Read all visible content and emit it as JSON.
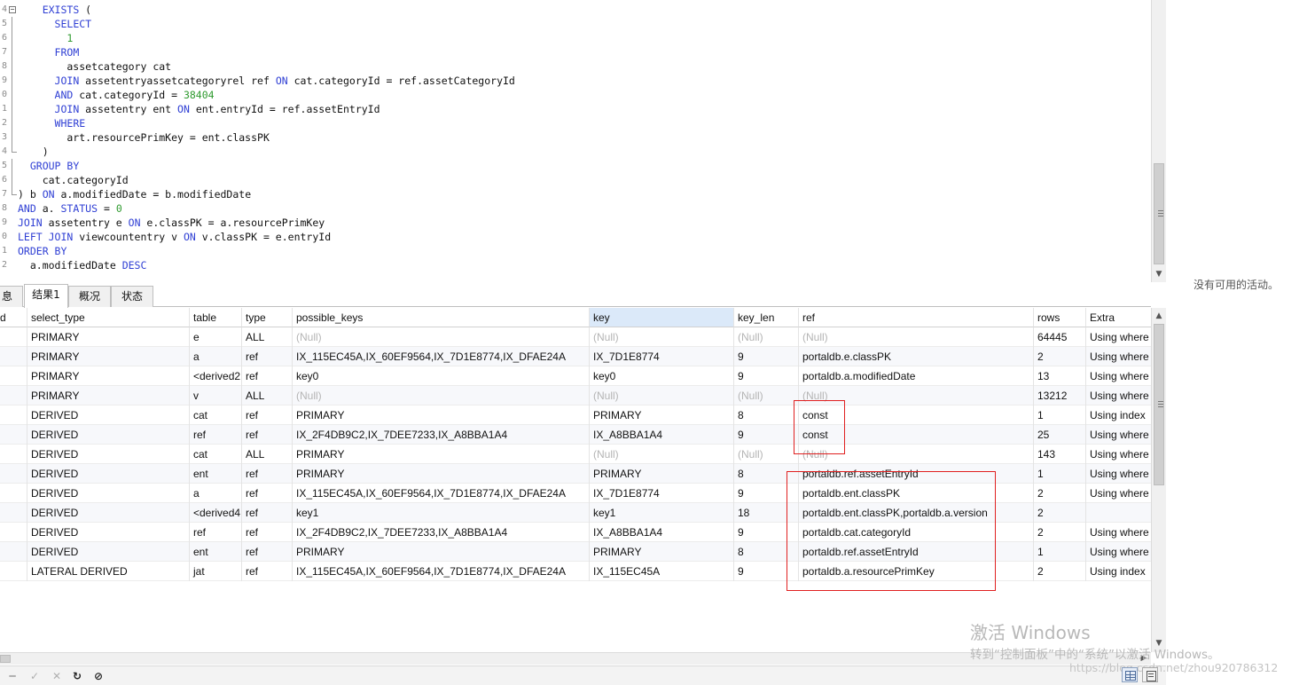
{
  "editor": {
    "lines": [
      {
        "num": "4",
        "fold": "box",
        "tokens": [
          [
            "tx",
            "    "
          ],
          [
            "kw",
            "EXISTS"
          ],
          [
            "tx",
            " ("
          ]
        ]
      },
      {
        "num": "5",
        "fold": "line",
        "tokens": [
          [
            "tx",
            "      "
          ],
          [
            "kw",
            "SELECT"
          ]
        ]
      },
      {
        "num": "6",
        "fold": "line",
        "tokens": [
          [
            "tx",
            "        "
          ],
          [
            "num",
            "1"
          ]
        ]
      },
      {
        "num": "7",
        "fold": "line",
        "tokens": [
          [
            "tx",
            "      "
          ],
          [
            "kw",
            "FROM"
          ]
        ]
      },
      {
        "num": "8",
        "fold": "line",
        "tokens": [
          [
            "tx",
            "        assetcategory cat"
          ]
        ]
      },
      {
        "num": "9",
        "fold": "line",
        "tokens": [
          [
            "tx",
            "      "
          ],
          [
            "kw",
            "JOIN"
          ],
          [
            "tx",
            " assetentryassetcategoryrel ref "
          ],
          [
            "kw",
            "ON"
          ],
          [
            "tx",
            " cat.categoryId = ref.assetCategoryId"
          ]
        ]
      },
      {
        "num": "0",
        "fold": "line",
        "tokens": [
          [
            "tx",
            "      "
          ],
          [
            "kw",
            "AND"
          ],
          [
            "tx",
            " cat.categoryId = "
          ],
          [
            "num",
            "38404"
          ]
        ]
      },
      {
        "num": "1",
        "fold": "line",
        "tokens": [
          [
            "tx",
            "      "
          ],
          [
            "kw",
            "JOIN"
          ],
          [
            "tx",
            " assetentry ent "
          ],
          [
            "kw",
            "ON"
          ],
          [
            "tx",
            " ent.entryId = ref.assetEntryId"
          ]
        ]
      },
      {
        "num": "2",
        "fold": "line",
        "tokens": [
          [
            "tx",
            "      "
          ],
          [
            "kw",
            "WHERE"
          ]
        ]
      },
      {
        "num": "3",
        "fold": "line",
        "tokens": [
          [
            "tx",
            "        art.resourcePrimKey = ent.classPK"
          ]
        ]
      },
      {
        "num": "4",
        "fold": "end",
        "tokens": [
          [
            "tx",
            "    )"
          ]
        ]
      },
      {
        "num": "5",
        "fold": "line",
        "tokens": [
          [
            "tx",
            "  "
          ],
          [
            "kw",
            "GROUP BY"
          ]
        ]
      },
      {
        "num": "6",
        "fold": "line",
        "tokens": [
          [
            "tx",
            "    cat.categoryId"
          ]
        ]
      },
      {
        "num": "7",
        "fold": "end",
        "tokens": [
          [
            "tx",
            ") b "
          ],
          [
            "kw",
            "ON"
          ],
          [
            "tx",
            " a.modifiedDate = b.modifiedDate"
          ]
        ]
      },
      {
        "num": "8",
        "fold": "",
        "tokens": [
          [
            "kw",
            "AND"
          ],
          [
            "tx",
            " a. "
          ],
          [
            "kw",
            "STATUS"
          ],
          [
            "tx",
            " = "
          ],
          [
            "num",
            "0"
          ]
        ]
      },
      {
        "num": "9",
        "fold": "",
        "tokens": [
          [
            "kw",
            "JOIN"
          ],
          [
            "tx",
            " assetentry e "
          ],
          [
            "kw",
            "ON"
          ],
          [
            "tx",
            " e.classPK = a.resourcePrimKey"
          ]
        ]
      },
      {
        "num": "0",
        "fold": "",
        "tokens": [
          [
            "kw",
            "LEFT JOIN"
          ],
          [
            "tx",
            " viewcountentry v "
          ],
          [
            "kw",
            "ON"
          ],
          [
            "tx",
            " v.classPK = e.entryId"
          ]
        ]
      },
      {
        "num": "1",
        "fold": "",
        "tokens": [
          [
            "kw",
            "ORDER BY"
          ]
        ]
      },
      {
        "num": "2",
        "fold": "",
        "tokens": [
          [
            "tx",
            "  a.modifiedDate "
          ],
          [
            "kw",
            "DESC"
          ]
        ]
      }
    ]
  },
  "tabs": [
    {
      "label": "息",
      "active": false
    },
    {
      "label": "结果1",
      "active": true
    },
    {
      "label": "概况",
      "active": false
    },
    {
      "label": "状态",
      "active": false
    }
  ],
  "grid": {
    "columns": [
      "d",
      "select_type",
      "table",
      "type",
      "possible_keys",
      "key",
      "key_len",
      "ref",
      "rows",
      "Extra"
    ],
    "selected_column": "key",
    "null_text": "(Null)",
    "rows": [
      [
        "",
        "PRIMARY",
        "e",
        "ALL",
        null,
        null,
        null,
        null,
        "64445",
        "Using where"
      ],
      [
        "",
        "PRIMARY",
        "a",
        "ref",
        "IX_115EC45A,IX_60EF9564,IX_7D1E8774,IX_DFAE24A",
        "IX_7D1E8774",
        "9",
        "portaldb.e.classPK",
        "2",
        "Using where"
      ],
      [
        "",
        "PRIMARY",
        "<derived2",
        "ref",
        "key0",
        "key0",
        "9",
        "portaldb.a.modifiedDate",
        "13",
        "Using where"
      ],
      [
        "",
        "PRIMARY",
        "v",
        "ALL",
        null,
        null,
        null,
        null,
        "13212",
        "Using where"
      ],
      [
        "",
        "DERIVED",
        "cat",
        "ref",
        "PRIMARY",
        "PRIMARY",
        "8",
        "const",
        "1",
        "Using index"
      ],
      [
        "",
        "DERIVED",
        "ref",
        "ref",
        "IX_2F4DB9C2,IX_7DEE7233,IX_A8BBA1A4",
        "IX_A8BBA1A4",
        "9",
        "const",
        "25",
        "Using where"
      ],
      [
        "",
        "DERIVED",
        "cat",
        "ALL",
        "PRIMARY",
        null,
        null,
        null,
        "143",
        "Using where"
      ],
      [
        "",
        "DERIVED",
        "ent",
        "ref",
        "PRIMARY",
        "PRIMARY",
        "8",
        "portaldb.ref.assetEntryId",
        "1",
        "Using where"
      ],
      [
        "",
        "DERIVED",
        "a",
        "ref",
        "IX_115EC45A,IX_60EF9564,IX_7D1E8774,IX_DFAE24A",
        "IX_7D1E8774",
        "9",
        "portaldb.ent.classPK",
        "2",
        "Using where"
      ],
      [
        "",
        "DERIVED",
        "<derived4",
        "ref",
        "key1",
        "key1",
        "18",
        "portaldb.ent.classPK,portaldb.a.version",
        "2",
        ""
      ],
      [
        "",
        "DERIVED",
        "ref",
        "ref",
        "IX_2F4DB9C2,IX_7DEE7233,IX_A8BBA1A4",
        "IX_A8BBA1A4",
        "9",
        "portaldb.cat.categoryId",
        "2",
        "Using where"
      ],
      [
        "",
        "DERIVED",
        "ent",
        "ref",
        "PRIMARY",
        "PRIMARY",
        "8",
        "portaldb.ref.assetEntryId",
        "1",
        "Using where"
      ],
      [
        "",
        "LATERAL DERIVED",
        "jat",
        "ref",
        "IX_115EC45A,IX_60EF9564,IX_7D1E8774,IX_DFAE24A",
        "IX_115EC45A",
        "9",
        "portaldb.a.resourcePrimKey",
        "2",
        "Using index"
      ]
    ]
  },
  "right_panel": {
    "empty_text": "没有可用的活动。"
  },
  "watermark": {
    "title": "激活 Windows",
    "subtitle": "转到“控制面板”中的“系统”以激活 Windows。",
    "url": "https://blog.csdn.net/zhou920786312"
  },
  "colors": {
    "keyword": "#2f3fd4",
    "number": "#2e9a2e",
    "annotation": "#e02020",
    "selected_header": "#dbe9f9"
  }
}
